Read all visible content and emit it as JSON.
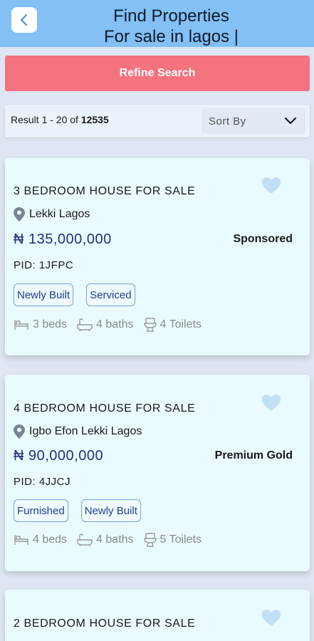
{
  "header": {
    "title_line1": "Find Properties",
    "title_line2": "For sale in lagos |"
  },
  "refine_label": "Refine Search",
  "results": {
    "prefix": "Result 1 - 20 of ",
    "total": "12535",
    "sort_label": "Sort By"
  },
  "listings": [
    {
      "title": "3 BEDROOM HOUSE FOR SALE",
      "location": "Lekki Lagos",
      "price": "₦ 135,000,000",
      "badge": "Sponsored",
      "pid": "PID: 1JFPC",
      "tags": [
        "Newly Built",
        "Serviced"
      ],
      "beds": "3 beds",
      "baths": "4 baths",
      "toilets": "4 Toilets"
    },
    {
      "title": "4 BEDROOM HOUSE FOR SALE",
      "location": "Igbo Efon Lekki Lagos",
      "price": "₦ 90,000,000",
      "badge": "Premium Gold",
      "pid": "PID: 4JJCJ",
      "tags": [
        "Furnished",
        "Newly Built"
      ],
      "beds": "4 beds",
      "baths": "4 baths",
      "toilets": "5 Toilets"
    },
    {
      "title": "2 BEDROOM HOUSE FOR SALE"
    }
  ],
  "colors": {
    "header": "#82c0f5",
    "refine": "#f4737f",
    "price": "#232f7f",
    "card": "#e9fbfe",
    "heart": "#bfe0f7"
  }
}
